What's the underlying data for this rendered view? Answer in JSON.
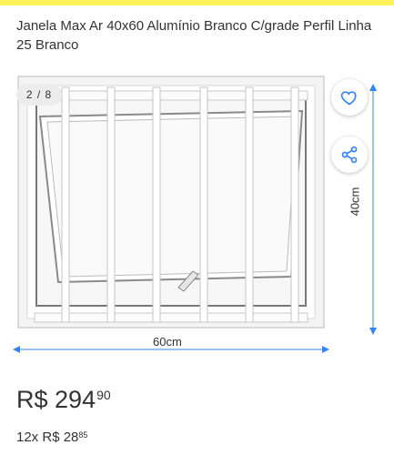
{
  "product": {
    "title": "Janela Max Ar 40x60 Alumínio Branco C/grade Perfil Linha 25 Branco"
  },
  "gallery": {
    "counter": "2 / 8",
    "favorite_icon": "heart-icon",
    "share_icon": "share-icon",
    "width_label": "60cm",
    "height_label": "40cm"
  },
  "price": {
    "currency": "R$",
    "amount": "294",
    "cents": "90"
  },
  "installments": {
    "count": "12x",
    "currency": "R$",
    "amount": "28",
    "cents": "85"
  },
  "colors": {
    "top_bar": "#fff159",
    "accent_blue": "#3483fa"
  }
}
